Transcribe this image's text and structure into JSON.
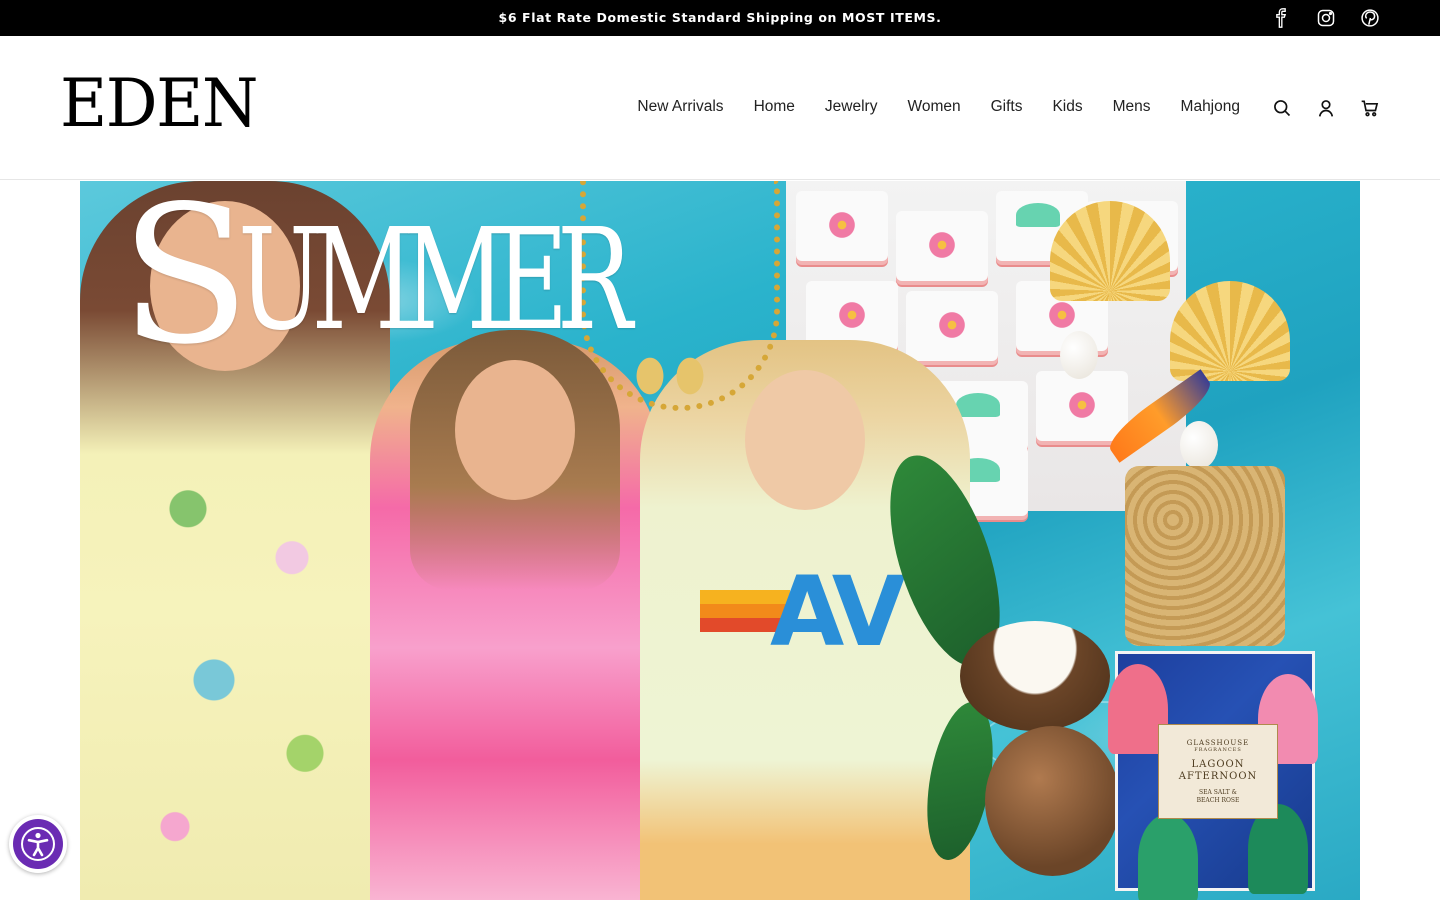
{
  "announcement": {
    "text": "$6 Flat Rate Domestic Standard Shipping on MOST ITEMS."
  },
  "social": [
    {
      "name": "facebook",
      "icon": "facebook-icon"
    },
    {
      "name": "instagram",
      "icon": "instagram-icon"
    },
    {
      "name": "pinterest",
      "icon": "pinterest-icon"
    }
  ],
  "header": {
    "logo": "EDEN",
    "nav": [
      {
        "label": "New Arrivals"
      },
      {
        "label": "Home"
      },
      {
        "label": "Jewelry"
      },
      {
        "label": "Women"
      },
      {
        "label": "Gifts"
      },
      {
        "label": "Kids"
      },
      {
        "label": "Mens"
      },
      {
        "label": "Mahjong"
      }
    ],
    "icons": [
      "search-icon",
      "account-icon",
      "cart-icon"
    ]
  },
  "hero": {
    "headline_first": "S",
    "headline_rest": "UMMER",
    "tee_graphic": "AV",
    "product_box": {
      "brand": "GLASSHOUSE",
      "sub": "FRAGRANCES",
      "name_line1": "LAGOON",
      "name_line2": "AFTERNOON",
      "scent_line1": "SEA SALT &",
      "scent_line2": "BEACH ROSE"
    }
  },
  "colors": {
    "announcement_bg": "#000000",
    "text": "#1a1a1a",
    "accessibility_purple": "#6a2bb3",
    "water": "#2ab3cc"
  },
  "accessibility": {
    "icon": "accessibility-icon"
  }
}
